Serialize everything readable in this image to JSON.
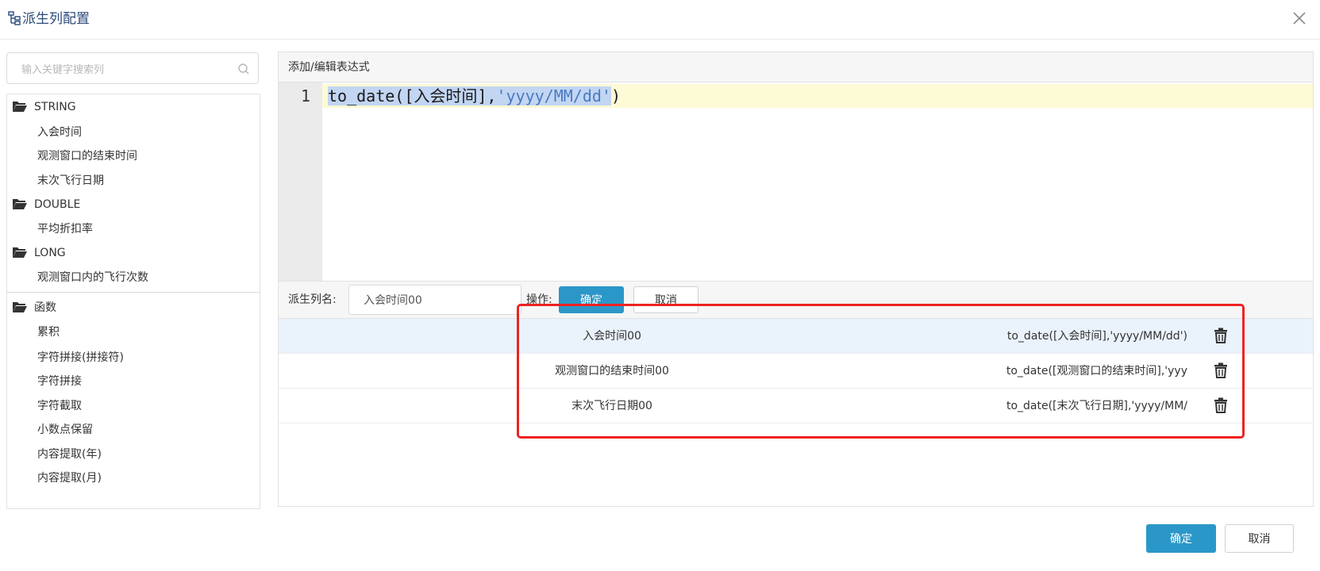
{
  "dialog": {
    "title": "派生列配置"
  },
  "search": {
    "placeholder": "输入关键字搜索列"
  },
  "tree": {
    "groups": [
      {
        "label": "STRING",
        "items": [
          "入会时间",
          "观测窗口的结束时间",
          "末次飞行日期"
        ]
      },
      {
        "label": "DOUBLE",
        "items": [
          "平均折扣率"
        ]
      },
      {
        "label": "LONG",
        "items": [
          "观测窗口内的飞行次数"
        ]
      },
      {
        "label": "函数",
        "items": [
          "累积",
          "字符拼接(拼接符)",
          "字符拼接",
          "字符截取",
          "小数点保留",
          "内容提取(年)",
          "内容提取(月)"
        ]
      }
    ]
  },
  "editor": {
    "header": "添加/编辑表达式",
    "line_number": "1",
    "code_prefix": "to_date([入会时间],",
    "code_string": "'yyyy/MM/dd'",
    "code_suffix": ")"
  },
  "form": {
    "name_label": "派生列名:",
    "name_value": "入会时间00",
    "op_label": "操作:",
    "confirm_label": "确定",
    "cancel_label": "取消"
  },
  "results": [
    {
      "name": "入会时间00",
      "expr": "to_date([入会时间],'yyyy/MM/dd')"
    },
    {
      "name": "观测窗口的结束时间00",
      "expr": "to_date([观测窗口的结束时间],'yyy"
    },
    {
      "name": "末次飞行日期00",
      "expr": "to_date([末次飞行日期],'yyyy/MM/"
    }
  ],
  "footer": {
    "confirm_label": "确定",
    "cancel_label": "取消"
  },
  "colors": {
    "primary": "#2b97c9",
    "highlight": "#ee2222",
    "selected_row": "#eaf2fc"
  }
}
